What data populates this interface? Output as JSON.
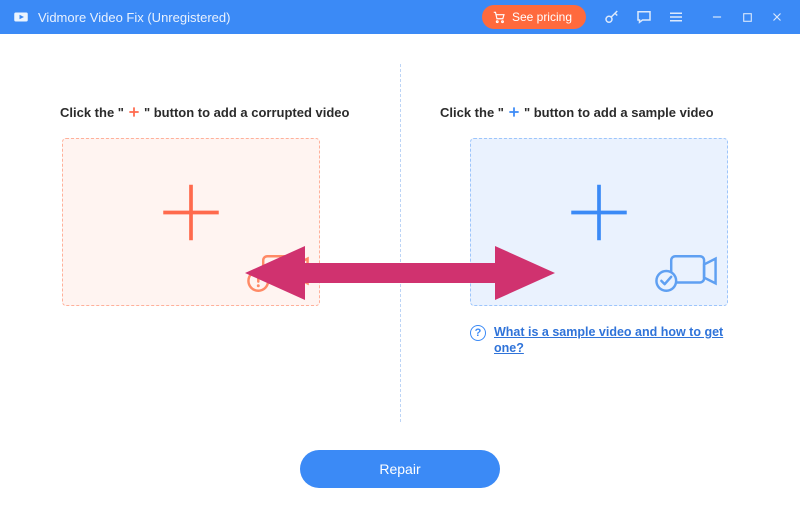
{
  "titlebar": {
    "app_title": "Vidmore Video Fix (Unregistered)",
    "pricing_label": "See pricing"
  },
  "left": {
    "instruction_pre": "Click the \"",
    "instruction_post": "\" button to add a corrupted video"
  },
  "right": {
    "instruction_pre": "Click the \"",
    "instruction_post": "\" button to add a sample video",
    "help_link": "What is a sample video and how to get one?"
  },
  "footer": {
    "repair_label": "Repair"
  },
  "colors": {
    "primary": "#3b8af6",
    "accent": "#ff6a3d",
    "arrow": "#d0326f"
  }
}
